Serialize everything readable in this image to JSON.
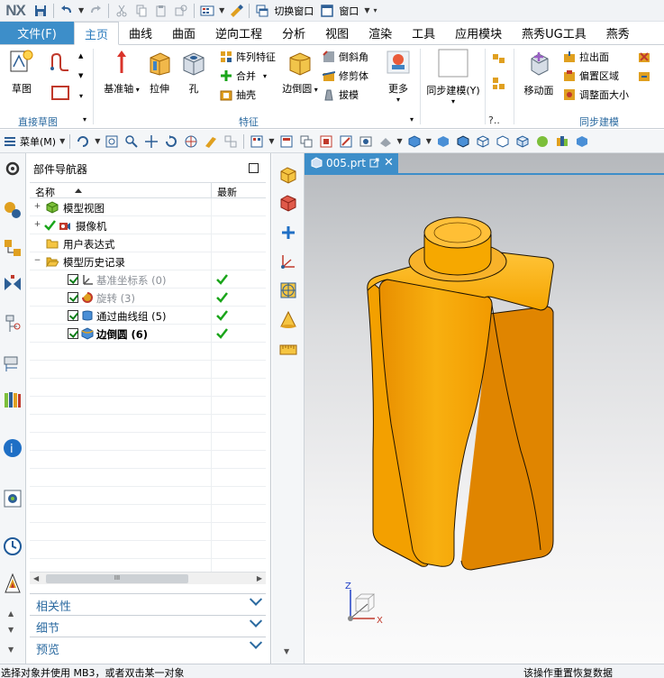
{
  "app": {
    "logo": "NX"
  },
  "quick_access": {
    "switch_window_label": "切换窗口",
    "window_label": "窗口"
  },
  "menu": {
    "file_label": "文件(F)",
    "tabs": [
      "主页",
      "曲线",
      "曲面",
      "逆向工程",
      "分析",
      "视图",
      "渲染",
      "工具",
      "应用模块",
      "燕秀UG工具",
      "燕秀"
    ],
    "active_tab": "主页"
  },
  "ribbon": {
    "direct_sketch": {
      "title": "直接草图",
      "sketch_label": "草图"
    },
    "feature": {
      "title": "特征",
      "datum_label": "基准轴",
      "extrude_label": "拉伸",
      "hole_label": "孔",
      "pattern_label": "阵列特征",
      "unite_label": "合并",
      "shell_label": "抽壳",
      "edge_blend_label": "边倒圆",
      "chamfer_label": "倒斜角",
      "trim_body_label": "修剪体",
      "draft_label": "拔模",
      "more_label": "更多"
    },
    "sync_modeling": {
      "title": "同步建模",
      "sync_label": "同步建模(Y)",
      "move_face_label": "移动面",
      "pull_face_label": "拉出面",
      "offset_region_label": "偏置区域",
      "resize_face_label": "调整面大小",
      "collapsed_title": "?.."
    }
  },
  "toolbar2": {
    "menu_label": "菜单(M)"
  },
  "navigator": {
    "title": "部件导航器",
    "columns": {
      "name": "名称",
      "latest": "最新"
    },
    "rows": [
      {
        "label": "模型视图",
        "icon": "model-views-icon"
      },
      {
        "label": "摄像机",
        "icon": "camera-icon"
      },
      {
        "label": "用户表达式",
        "icon": "folder-icon"
      },
      {
        "label": "模型历史记录",
        "icon": "folder-open-icon"
      },
      {
        "label": "基准坐标系 (0)",
        "icon": "datum-csys-icon",
        "latest": true
      },
      {
        "label": "旋转 (3)",
        "icon": "revolve-icon",
        "latest": true
      },
      {
        "label": "通过曲线组 (5)",
        "icon": "through-curves-icon",
        "latest": true
      },
      {
        "label": "边倒圆 (6)",
        "icon": "edge-blend-icon",
        "latest": true
      }
    ],
    "scroll_thumb_text": "III",
    "sections": [
      "相关性",
      "细节",
      "预览"
    ]
  },
  "document": {
    "tab_name": "005.prt"
  },
  "triad": {
    "z_label": "Z",
    "x_label": "X"
  },
  "status": {
    "left": "选择对象并使用 MB3，或者双击某一对象",
    "right": "该操作重置恢复数据"
  },
  "colors": {
    "accent_blue": "#3d8ec9",
    "model_orange": "#f5a400",
    "check_green": "#1aa51a"
  }
}
